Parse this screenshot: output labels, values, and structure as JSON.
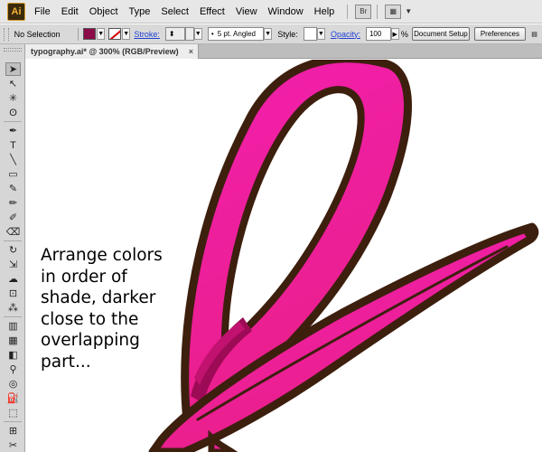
{
  "app": {
    "logo_text": "Ai"
  },
  "menu": {
    "items": [
      "File",
      "Edit",
      "Object",
      "Type",
      "Select",
      "Effect",
      "View",
      "Window",
      "Help"
    ],
    "bridge_icon_label": "Br"
  },
  "control_bar": {
    "selection_label": "No Selection",
    "fill_color": "#8b0a48",
    "stroke_label": "Stroke:",
    "brush_value": "5 pt. Angled",
    "style_label": "Style:",
    "opacity_label": "Opacity:",
    "opacity_value": "100",
    "opacity_unit": "%",
    "document_setup_label": "Document Setup",
    "preferences_label": "Preferences"
  },
  "document": {
    "tab_title": "typography.ai* @ 300% (RGB/Preview)",
    "close_glyph": "×"
  },
  "tools": [
    {
      "name": "selection-tool-icon",
      "glyph": "➤",
      "selected": true
    },
    {
      "name": "direct-selection-tool-icon",
      "glyph": "↖"
    },
    {
      "name": "magic-wand-tool-icon",
      "glyph": "✳"
    },
    {
      "name": "lasso-tool-icon",
      "glyph": "ʘ"
    },
    {
      "name": "pen-tool-icon",
      "glyph": "✒"
    },
    {
      "name": "type-tool-icon",
      "glyph": "T"
    },
    {
      "name": "line-segment-tool-icon",
      "glyph": "╲"
    },
    {
      "name": "rectangle-tool-icon",
      "glyph": "▭"
    },
    {
      "name": "paintbrush-tool-icon",
      "glyph": "✎"
    },
    {
      "name": "pencil-tool-icon",
      "glyph": "✏"
    },
    {
      "name": "blob-brush-tool-icon",
      "glyph": "✐"
    },
    {
      "name": "eraser-tool-icon",
      "glyph": "⌫"
    },
    {
      "name": "rotate-tool-icon",
      "glyph": "↻"
    },
    {
      "name": "scale-tool-icon",
      "glyph": "⇲"
    },
    {
      "name": "warp-tool-icon",
      "glyph": "☁"
    },
    {
      "name": "free-transform-tool-icon",
      "glyph": "⊡"
    },
    {
      "name": "symbol-sprayer-tool-icon",
      "glyph": "⁂"
    },
    {
      "name": "column-graph-tool-icon",
      "glyph": "▥"
    },
    {
      "name": "mesh-tool-icon",
      "glyph": "▦"
    },
    {
      "name": "gradient-tool-icon",
      "glyph": "◧"
    },
    {
      "name": "eyedropper-tool-icon",
      "glyph": "⚲"
    },
    {
      "name": "blend-tool-icon",
      "glyph": "◎"
    },
    {
      "name": "live-paint-bucket-tool-icon",
      "glyph": "⛽"
    },
    {
      "name": "live-paint-selection-tool-icon",
      "glyph": "⬚"
    },
    {
      "name": "artboard-tool-icon",
      "glyph": "⊞"
    },
    {
      "name": "slice-tool-icon",
      "glyph": "✂"
    },
    {
      "name": "hand-tool-icon",
      "glyph": "✋"
    }
  ],
  "artwork": {
    "outline_color": "#3d1f0e",
    "pink_light": "#f21fae",
    "pink_mid": "#ea1f8a",
    "pink_dark": "#9d0a55"
  },
  "caption": "Arrange colors\nin order of\nshade, darker\nclose to the\noverlapping\npart..."
}
